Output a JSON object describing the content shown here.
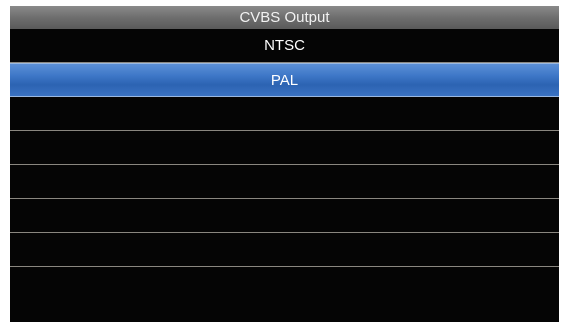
{
  "screen": {
    "title": "CVBS Output"
  },
  "menu": {
    "items": [
      {
        "label": "NTSC",
        "selected": false
      },
      {
        "label": "PAL",
        "selected": true
      },
      {
        "label": "",
        "selected": false
      },
      {
        "label": "",
        "selected": false
      },
      {
        "label": "",
        "selected": false
      },
      {
        "label": "",
        "selected": false
      },
      {
        "label": "",
        "selected": false
      }
    ]
  },
  "colors": {
    "highlight": "#3f78c8",
    "background": "#050505",
    "title_bar": "#6e6e6e",
    "divider": "#8a8780"
  }
}
